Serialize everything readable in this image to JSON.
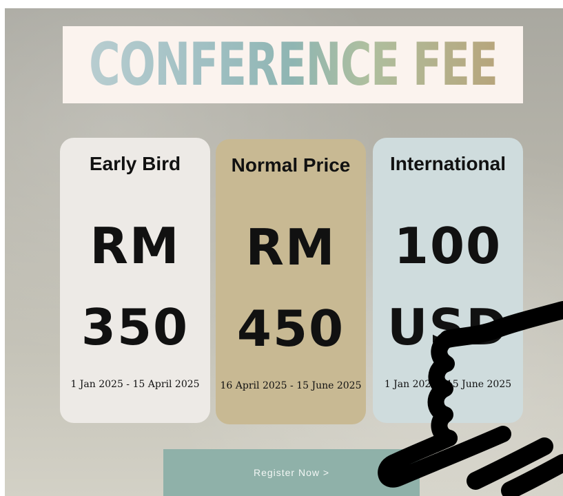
{
  "header": {
    "title": "CONFERENCE FEE"
  },
  "pricing": {
    "cards": [
      {
        "title": "Early Bird",
        "price_line1": "RM",
        "price_line2": "350",
        "dates": "1 Jan 2025 - 15 April 2025"
      },
      {
        "title": "Normal Price",
        "price_line1": "RM",
        "price_line2": "450",
        "dates": "16 April 2025 - 15 June 2025"
      },
      {
        "title": "International",
        "price_line1": "100",
        "price_line2": "USD",
        "dates": "1 Jan 2025 - 15 June 2025"
      }
    ]
  },
  "cta": {
    "label": "Register Now >"
  },
  "cursor": {
    "icon": "pointing-hand-icon"
  },
  "colors": {
    "early_card": "#edeae6",
    "normal_card": "#c8b993",
    "international_card": "#cfdcdd",
    "register_button": "#8fb1a9"
  }
}
